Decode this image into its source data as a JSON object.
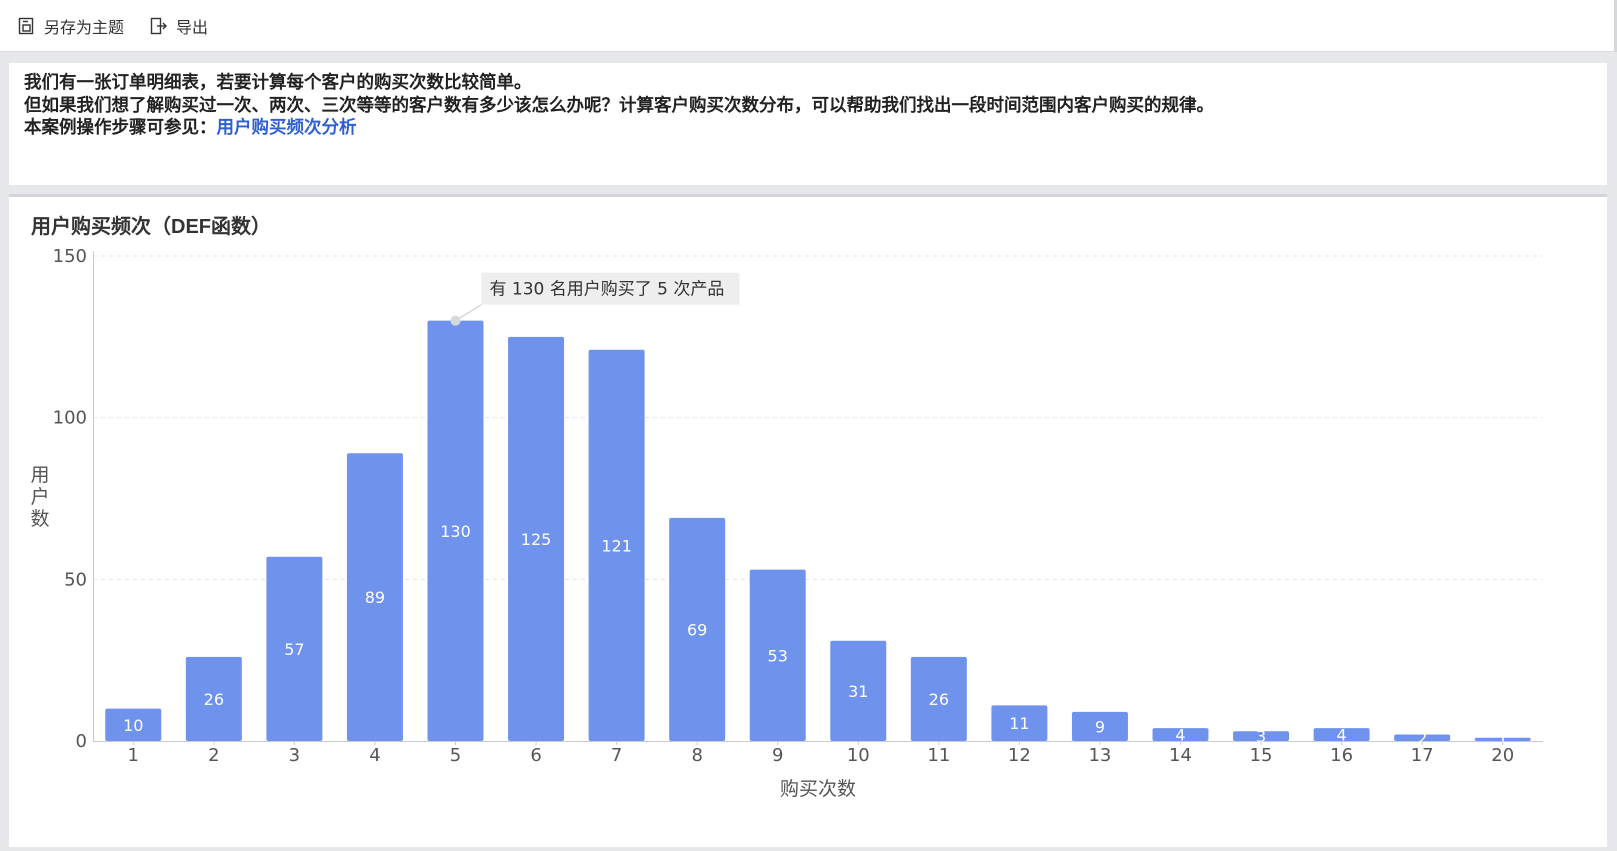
{
  "toolbar": {
    "save_theme_label": "另存为主题",
    "export_label": "导出",
    "save_theme_icon": "save-theme-icon",
    "export_icon": "export-icon"
  },
  "intro": {
    "line1": "我们有一张订单明细表，若要计算每个客户的购买次数比较简单。",
    "line2": "但如果我们想了解购买过一次、两次、三次等等的客户数有多少该怎么办呢？计算客户购买次数分布，可以帮助我们找出一段时间范围内客户购买的规律。",
    "line3_prefix": "本案例操作步骤可参见：",
    "line3_link": "用户购买频次分析",
    "link_color": "#2f5fd1"
  },
  "card": {
    "title": "用户购买频次（DEF函数）"
  },
  "tooltip": {
    "text": "有 130 名用户购买了 5 次产品",
    "category": "5"
  },
  "chart_data": {
    "type": "bar",
    "categories": [
      "1",
      "2",
      "3",
      "4",
      "5",
      "6",
      "7",
      "8",
      "9",
      "10",
      "11",
      "12",
      "13",
      "14",
      "15",
      "16",
      "17",
      "20"
    ],
    "values": [
      10,
      26,
      57,
      89,
      130,
      125,
      121,
      69,
      53,
      31,
      26,
      11,
      9,
      4,
      3,
      4,
      2,
      1
    ],
    "xlabel": "购买次数",
    "ylabel": "用户数",
    "ylim": [
      0,
      150
    ],
    "yticks": [
      0,
      50,
      100,
      150
    ],
    "grid": true,
    "bar_color": "#6f93ec",
    "data_labels": true
  }
}
